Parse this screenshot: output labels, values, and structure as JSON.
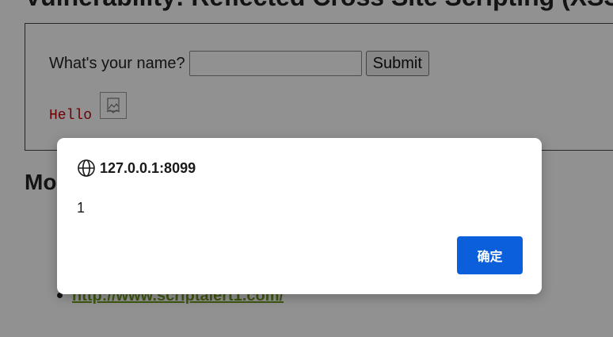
{
  "page": {
    "heading": "Vulnerability: Reflected Cross Site Scripting (XSS)",
    "form": {
      "name_label": "What's your name?",
      "name_value": "",
      "submit_label": "Submit"
    },
    "output_text": "Hello",
    "more_heading": "More Information",
    "links": {
      "cut_link_tail": "t",
      "items": [
        "http://www.scriptalert1.com/"
      ]
    }
  },
  "dialog": {
    "origin": "127.0.0.1:8099",
    "message": "1",
    "ok_label": "确定",
    "icon": "globe-icon",
    "accent_color": "#0b5fdb"
  }
}
